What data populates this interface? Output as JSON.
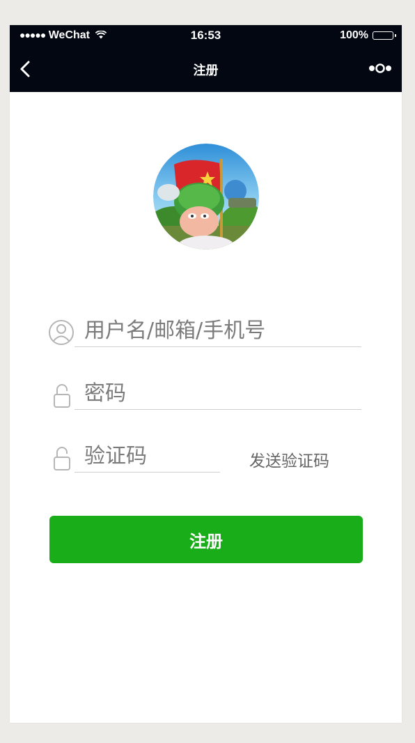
{
  "status_bar": {
    "signal_dots": "●●●●●",
    "carrier": "WeChat",
    "time": "16:53",
    "battery": "100%"
  },
  "nav": {
    "title": "注册",
    "back_icon": "chevron-left-icon",
    "more_icon": "more-dots-icon"
  },
  "form": {
    "username_placeholder": "用户名/邮箱/手机号",
    "password_placeholder": "密码",
    "code_placeholder": "验证码",
    "send_code_label": "发送验证码",
    "submit_label": "注册"
  },
  "colors": {
    "nav_bg": "#020712",
    "primary_button": "#1aad1a",
    "page_bg": "#ecebe8"
  }
}
